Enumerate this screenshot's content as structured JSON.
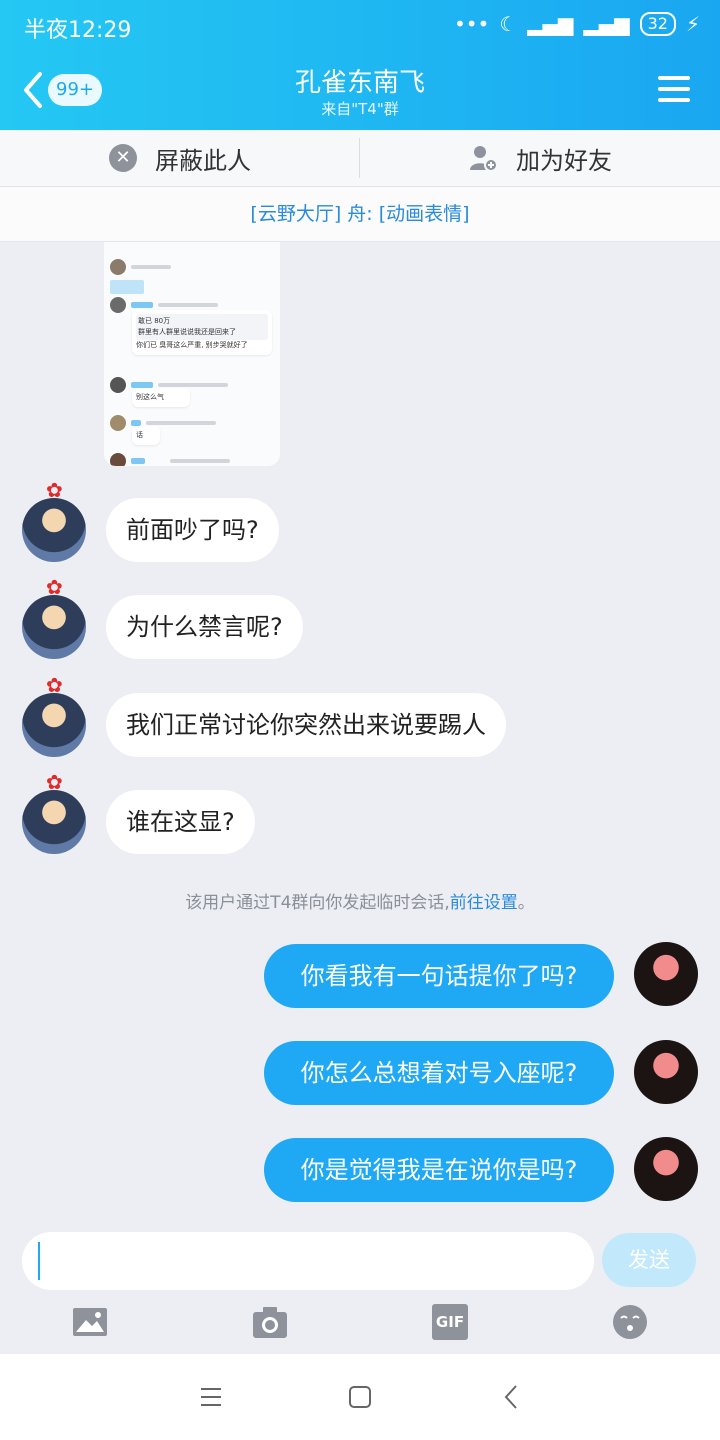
{
  "status": {
    "time": "半夜12:29",
    "battery": "32"
  },
  "header": {
    "badge": "99+",
    "title": "孔雀东南飞",
    "subtitle": "来自\"T4\"群"
  },
  "actions": {
    "block_label": "屏蔽此人",
    "add_friend_label": "加为好友"
  },
  "notice": "[云野大厅] 舟: [动画表情]",
  "screenshot_image": {
    "line1": "敢已 80万",
    "line2": "群里有人群里说说我还是回来了",
    "line3": "你们已 臭哥这么严重, 别步哭就好了",
    "line4": "别这么气",
    "line5": "话"
  },
  "incoming_messages": [
    {
      "text": "前面吵了吗?"
    },
    {
      "text": "为什么禁言呢?"
    },
    {
      "text": "我们正常讨论你突然出来说要踢人"
    },
    {
      "text": "谁在这显?"
    }
  ],
  "system_message": {
    "text": "该用户通过T4群向你发起临时会话,",
    "link": "前往设置",
    "tail": "。"
  },
  "outgoing_messages": [
    {
      "text": "你看我有一句话提你了吗?"
    },
    {
      "text": "你怎么总想着对号入座呢?"
    },
    {
      "text": "你是觉得我是在说你是吗?"
    }
  ],
  "input": {
    "placeholder": "",
    "send_label": "发送"
  },
  "toolbar": {
    "gif_label": "GIF"
  },
  "colors": {
    "header": "#1aa7f1",
    "bubble_out": "#1fa8f4",
    "link": "#2a8bdc",
    "background": "#eceef3"
  }
}
